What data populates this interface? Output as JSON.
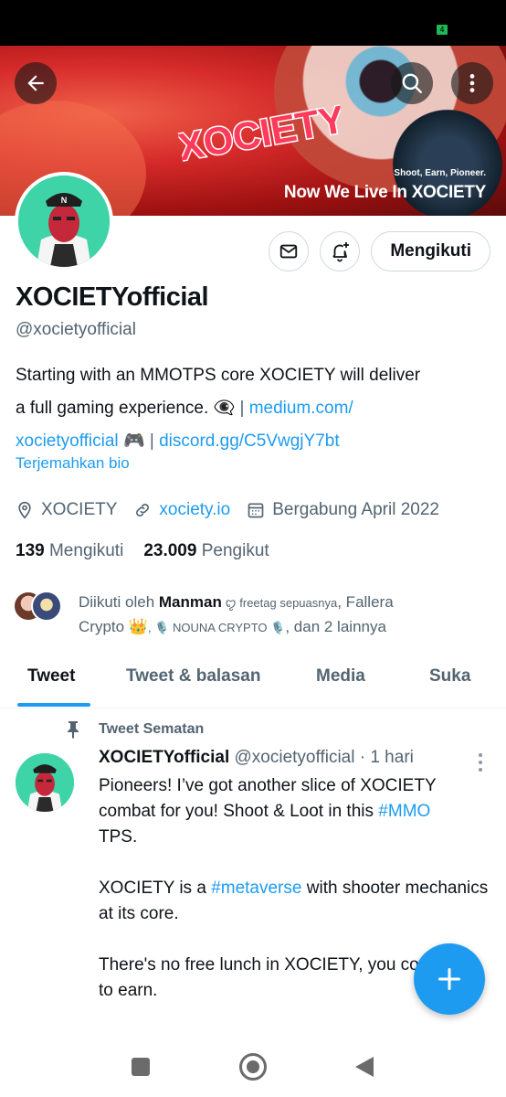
{
  "status_bar": {
    "battery": "4"
  },
  "banner": {
    "logo_text": "XOCIETY",
    "tagline": "Shoot, Earn, Pioneer.",
    "title": "Now We Live In XOCIETY"
  },
  "actions": {
    "follow_label": "Mengikuti"
  },
  "profile": {
    "name": "XOCIETYofficial",
    "handle": "@xocietyofficial",
    "bio_line1": "Starting with an MMOTPS core XOCIETY will deliver",
    "bio_line2_text": "a full gaming experience. ",
    "bio_line2_emoji": "👁‍🗨",
    "bio_link1_part1": "medium.com/",
    "bio_link1_part2": "xocietyofficial",
    "bio_game_emoji": "🎮",
    "bio_link2": "discord.gg/C5VwgjY7bt",
    "separator": "|",
    "translate_label": "Terjemahkan bio",
    "location": "XOCIETY",
    "website": "xociety.io",
    "joined": "Bergabung April 2022",
    "following_count": "139",
    "following_label": "Mengikuti",
    "followers_count": "23.009",
    "followers_label": "Pengikut"
  },
  "followed_by": {
    "prefix": "Diikuti oleh ",
    "user1": "Manman",
    "user1_deco": " ꨄ︎ freetag sepuasnya",
    "user2_line1": ", Fallera",
    "user2_line2": "Crypto 👑",
    "user3": ", 🎙️ NOUNA CRYPTO 🎙️",
    "suffix": ", dan 2 lainnya"
  },
  "tabs": [
    "Tweet",
    "Tweet & balasan",
    "Media",
    "Suka"
  ],
  "pinned_tweet": {
    "pinned_label": "Tweet Sematan",
    "author_name": "XOCIETYofficial",
    "author_handle": "@xocietyofficial",
    "time": "· 1 hari",
    "p1_a": "Pioneers! I’ve got another slice of XOCIETY combat for you!  Shoot & Loot in this ",
    "p1_tag": "#MMO",
    "p1_b": " TPS.",
    "p2_a": "XOCIETY is a ",
    "p2_tag": "#metaverse",
    "p2_b": " with shooter mechanics at its core.",
    "p3": "There's no free lunch in XOCIETY, you contribute to earn."
  },
  "colors": {
    "accent": "#1d9bf0",
    "text_primary": "#0f1419",
    "text_secondary": "#536471",
    "avatar_bg": "#3fd4a8",
    "banner_red": "#d52a2a"
  },
  "icons": {
    "back": "arrow-left-icon",
    "search": "search-icon",
    "more": "more-vertical-icon",
    "message": "envelope-icon",
    "notify": "bell-plus-icon",
    "location": "location-pin-icon",
    "website": "link-icon",
    "calendar": "calendar-icon",
    "pin": "pin-icon",
    "compose": "plus-icon"
  }
}
